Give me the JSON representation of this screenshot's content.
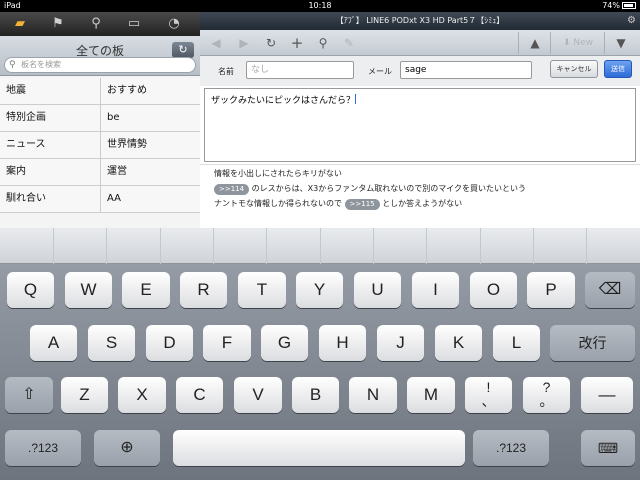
{
  "status_bar": {
    "device": "iPad",
    "time": "10:18",
    "battery": "74%"
  },
  "left_pane": {
    "title": "全ての板",
    "search_placeholder": "板名を検索",
    "boards": [
      [
        "地震",
        "おすすめ"
      ],
      [
        "特別企画",
        "be"
      ],
      [
        "ニュース",
        "世界情勢"
      ],
      [
        "案内",
        "運営"
      ],
      [
        "馴れ合い",
        "AA"
      ]
    ]
  },
  "thread_title": "【ｱﾌﾞ】 LINE6 PODxt X3 HD Part5７【ｼﾐｭ】",
  "toolbar": {
    "new_label": "New"
  },
  "reply_form": {
    "name_label": "名前",
    "name_placeholder": "なし",
    "mail_label": "メール",
    "mail_value": "sage",
    "cancel_label": "キャンセル",
    "send_label": "送信",
    "message": "ザックみたいにピックはさんだら？"
  },
  "thread_lines": {
    "line1": "情報を小出しにされたらキリがない",
    "anchor1": ">>114",
    "line2": "のレスからは、X3からファンタム取れないので別のマイクを買いたいという",
    "line3a": "ナントモな情報しか得られないので",
    "anchor2": ">>115",
    "line3b": "としか答えようがない"
  },
  "keyboard": {
    "row1": [
      "Q",
      "W",
      "E",
      "R",
      "T",
      "Y",
      "U",
      "I",
      "O",
      "P"
    ],
    "row2": [
      "A",
      "S",
      "D",
      "F",
      "G",
      "H",
      "J",
      "K",
      "L"
    ],
    "row3": [
      "Z",
      "X",
      "C",
      "V",
      "B",
      "N",
      "M"
    ],
    "return_label": "改行",
    "num_label": ".?123",
    "excl_top": "!",
    "excl_bottom": "、",
    "q_top": "?",
    "q_bottom": "。",
    "dash": "—"
  }
}
